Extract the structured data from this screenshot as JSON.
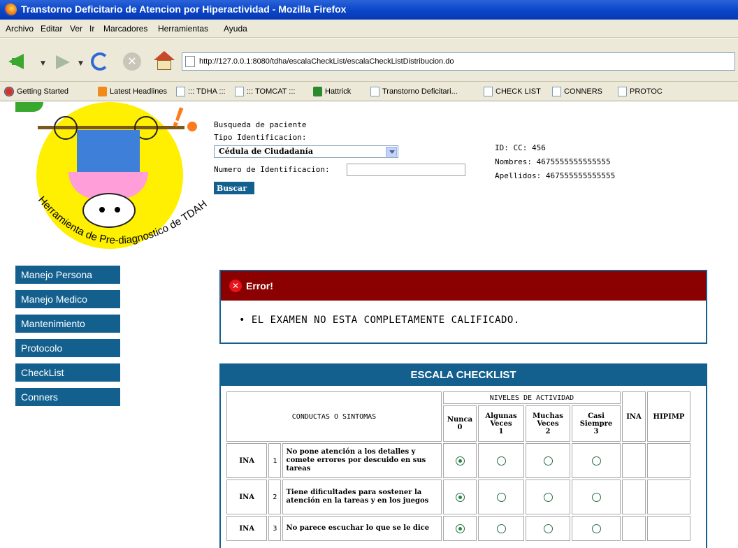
{
  "browser": {
    "title": "Transtorno Deficitario de Atencion por Hiperactividad - Mozilla Firefox",
    "menu": [
      "Archivo",
      "Editar",
      "Ver",
      "Ir",
      "Marcadores",
      "Herramientas",
      "Ayuda"
    ],
    "url": "http://127.0.0.1:8080/tdha/escalaCheckList/escalaCheckListDistribucion.do",
    "bookmarks": [
      "Getting Started",
      "Latest Headlines",
      "::: TDHA :::",
      "::: TOMCAT :::",
      "Hattrick",
      "Transtorno Deficitari...",
      "CHECK LIST",
      "CONNERS",
      "PROTOC"
    ]
  },
  "logo": {
    "caption": "Herramienta de Pre-diagnostico de TDAH"
  },
  "sidebar": {
    "items": [
      {
        "label": "Manejo Persona"
      },
      {
        "label": "Manejo Medico"
      },
      {
        "label": "Mantenimiento"
      },
      {
        "label": "Protocolo"
      },
      {
        "label": "CheckList"
      },
      {
        "label": "Conners"
      }
    ]
  },
  "search": {
    "heading": "Busqueda de paciente",
    "tipo_label": "Tipo Identificacion:",
    "tipo_value": "Cédula de Ciudadanía",
    "numero_label": "Numero de Identificacion:",
    "numero_value": "",
    "button": "Buscar"
  },
  "patient": {
    "id": "ID: CC: 456",
    "nombres": "Nombres: 4675555555555555",
    "apellidos": "Apellidos: 467555555555555"
  },
  "error": {
    "title": "Error!",
    "message": "EL EXAMEN NO ESTA COMPLETAMENTE CALIFICADO."
  },
  "checklist": {
    "title": "ESCALA CHECKLIST",
    "col_conductas": "CONDUCTAS O SINTOMAS",
    "col_niveles": "NIVELES DE ACTIVIDAD",
    "levels": [
      {
        "name": "Nunca",
        "value": "0"
      },
      {
        "name": "Algunas Veces",
        "value": "1"
      },
      {
        "name": "Muchas Veces",
        "value": "2"
      },
      {
        "name": "Casi Siempre",
        "value": "3"
      }
    ],
    "col_ina": "INA",
    "col_hipimp": "HIPIMP",
    "rows": [
      {
        "tipo": "INA",
        "num": "1",
        "text": "No pone atención a los detalles y comete errores por descuido en sus tareas",
        "selected": 0
      },
      {
        "tipo": "INA",
        "num": "2",
        "text": "Tiene dificultades para sostener la atención en la tareas y en los juegos",
        "selected": 0
      },
      {
        "tipo": "INA",
        "num": "3",
        "text": "No parece escuchar lo que se le dice",
        "selected": 0
      }
    ]
  }
}
